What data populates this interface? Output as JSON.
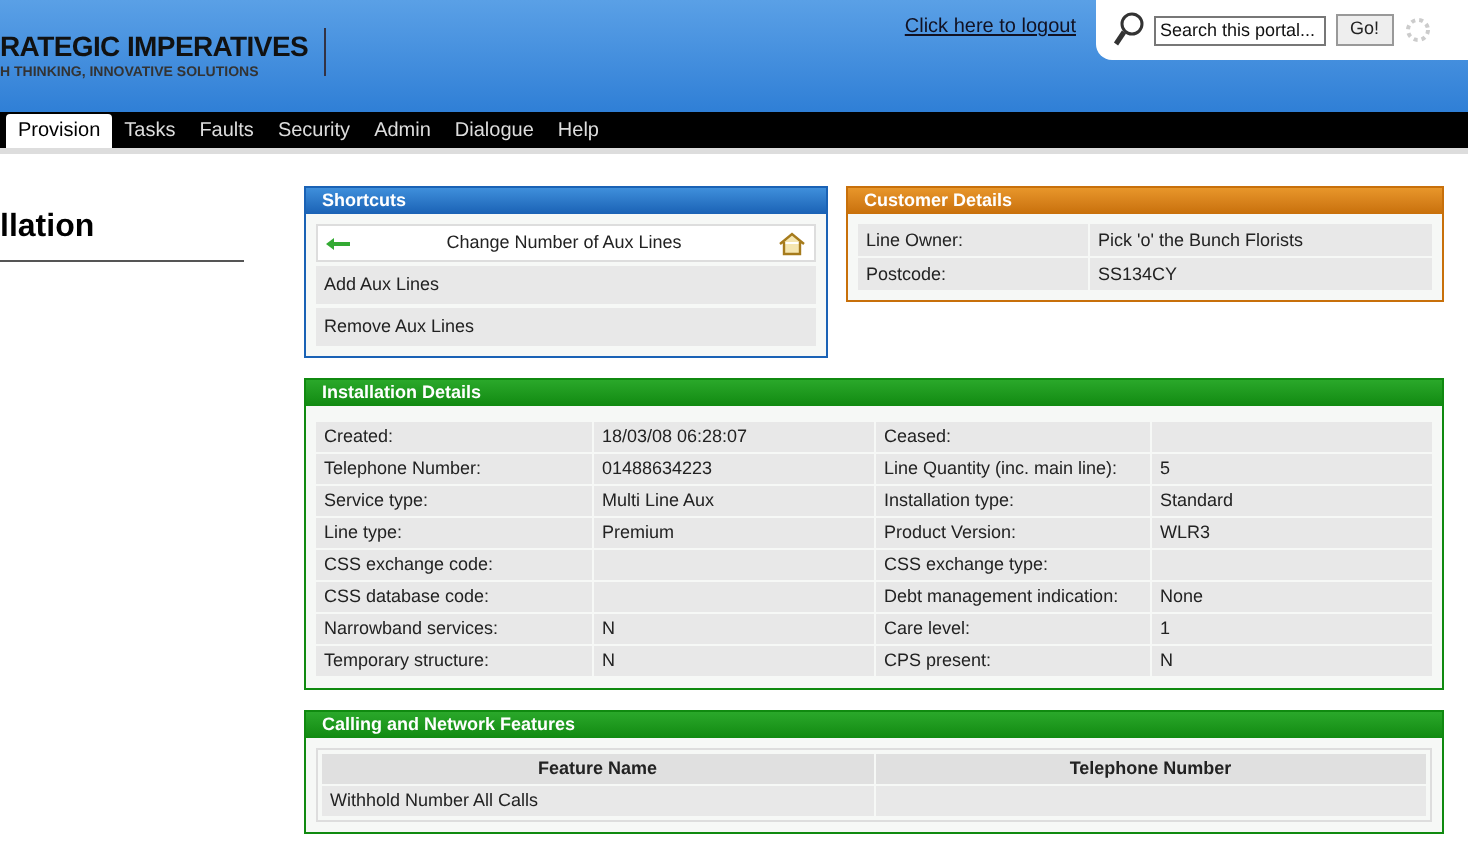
{
  "brand": {
    "name": "RATEGIC IMPERATIVES",
    "tagline": "H THINKING, INNOVATIVE SOLUTIONS"
  },
  "logout": "Click here to logout",
  "search": {
    "placeholder": "Search this portal...",
    "button": "Go!"
  },
  "tabs": [
    {
      "label": "Provision",
      "selected": true
    },
    {
      "label": "Tasks",
      "selected": false
    },
    {
      "label": "Faults",
      "selected": false
    },
    {
      "label": "Security",
      "selected": false
    },
    {
      "label": "Admin",
      "selected": false
    },
    {
      "label": "Dialogue",
      "selected": false
    },
    {
      "label": "Help",
      "selected": false
    }
  ],
  "page_title": "llation",
  "shortcuts": {
    "title": "Shortcuts",
    "items": [
      {
        "label": "Change Number of Aux Lines",
        "kind": "current"
      },
      {
        "label": "Add Aux Lines",
        "kind": "link"
      },
      {
        "label": "Remove Aux Lines",
        "kind": "link"
      }
    ]
  },
  "customer": {
    "title": "Customer Details",
    "rows": [
      {
        "label": "Line Owner:",
        "value": "Pick 'o' the Bunch Florists"
      },
      {
        "label": "Postcode:",
        "value": "SS134CY"
      }
    ]
  },
  "installation": {
    "title": "Installation Details",
    "rows": [
      {
        "label": "Created:",
        "value": "18/03/08 06:28:07",
        "label2": "Ceased:",
        "value2": ""
      },
      {
        "label": "Telephone Number:",
        "value": "01488634223",
        "label2": "Line Quantity (inc. main line):",
        "value2": "5"
      },
      {
        "label": "Service type:",
        "value": "Multi Line Aux",
        "label2": "Installation type:",
        "value2": "Standard"
      },
      {
        "label": "Line type:",
        "value": "Premium",
        "label2": "Product Version:",
        "value2": "WLR3"
      },
      {
        "label": "CSS exchange code:",
        "value": "",
        "label2": "CSS exchange type:",
        "value2": ""
      },
      {
        "label": "CSS database code:",
        "value": "",
        "label2": "Debt management indication:",
        "value2": "None"
      },
      {
        "label": "Narrowband services:",
        "value": "N",
        "label2": "Care level:",
        "value2": "1"
      },
      {
        "label": "Temporary structure:",
        "value": "N",
        "label2": "CPS present:",
        "value2": "N"
      }
    ]
  },
  "features": {
    "title": "Calling and Network Features",
    "columns": [
      "Feature Name",
      "Telephone Number"
    ],
    "rows": [
      [
        "Withhold Number All Calls",
        ""
      ]
    ]
  }
}
